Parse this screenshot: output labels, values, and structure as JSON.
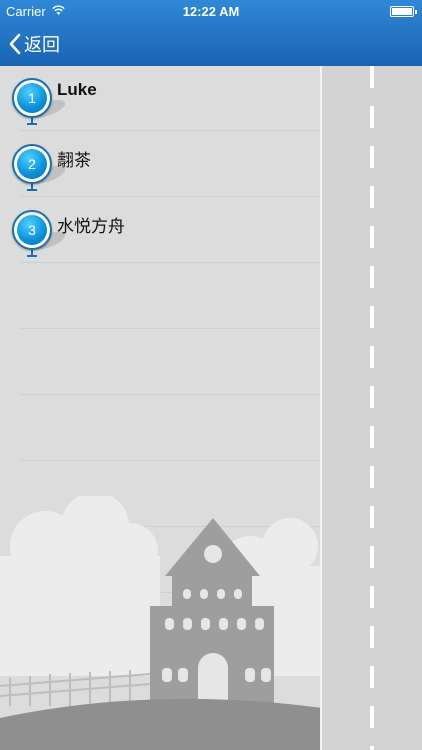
{
  "status_bar": {
    "carrier": "Carrier",
    "time": "12:22 AM"
  },
  "nav": {
    "back_label": "返回"
  },
  "items": [
    {
      "number": "1",
      "label": "Luke"
    },
    {
      "number": "2",
      "label": "翿茶"
    },
    {
      "number": "3",
      "label": "水悦方舟"
    }
  ],
  "colors": {
    "nav_bar": "#1f6fc1",
    "marker": "#0a8fd8",
    "background": "#dcdcdc"
  }
}
